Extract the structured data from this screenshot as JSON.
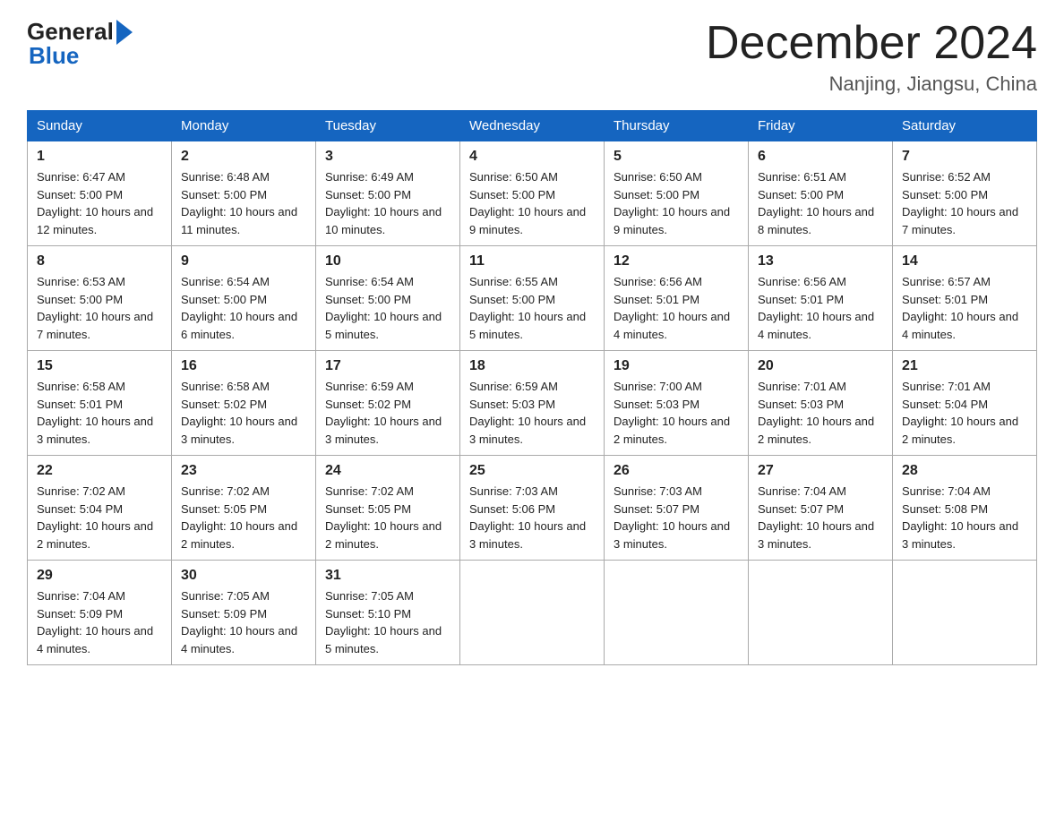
{
  "header": {
    "title": "December 2024",
    "location": "Nanjing, Jiangsu, China",
    "logo_general": "General",
    "logo_blue": "Blue"
  },
  "columns": [
    "Sunday",
    "Monday",
    "Tuesday",
    "Wednesday",
    "Thursday",
    "Friday",
    "Saturday"
  ],
  "weeks": [
    [
      {
        "day": "1",
        "sunrise": "6:47 AM",
        "sunset": "5:00 PM",
        "daylight": "10 hours and 12 minutes."
      },
      {
        "day": "2",
        "sunrise": "6:48 AM",
        "sunset": "5:00 PM",
        "daylight": "10 hours and 11 minutes."
      },
      {
        "day": "3",
        "sunrise": "6:49 AM",
        "sunset": "5:00 PM",
        "daylight": "10 hours and 10 minutes."
      },
      {
        "day": "4",
        "sunrise": "6:50 AM",
        "sunset": "5:00 PM",
        "daylight": "10 hours and 9 minutes."
      },
      {
        "day": "5",
        "sunrise": "6:50 AM",
        "sunset": "5:00 PM",
        "daylight": "10 hours and 9 minutes."
      },
      {
        "day": "6",
        "sunrise": "6:51 AM",
        "sunset": "5:00 PM",
        "daylight": "10 hours and 8 minutes."
      },
      {
        "day": "7",
        "sunrise": "6:52 AM",
        "sunset": "5:00 PM",
        "daylight": "10 hours and 7 minutes."
      }
    ],
    [
      {
        "day": "8",
        "sunrise": "6:53 AM",
        "sunset": "5:00 PM",
        "daylight": "10 hours and 7 minutes."
      },
      {
        "day": "9",
        "sunrise": "6:54 AM",
        "sunset": "5:00 PM",
        "daylight": "10 hours and 6 minutes."
      },
      {
        "day": "10",
        "sunrise": "6:54 AM",
        "sunset": "5:00 PM",
        "daylight": "10 hours and 5 minutes."
      },
      {
        "day": "11",
        "sunrise": "6:55 AM",
        "sunset": "5:00 PM",
        "daylight": "10 hours and 5 minutes."
      },
      {
        "day": "12",
        "sunrise": "6:56 AM",
        "sunset": "5:01 PM",
        "daylight": "10 hours and 4 minutes."
      },
      {
        "day": "13",
        "sunrise": "6:56 AM",
        "sunset": "5:01 PM",
        "daylight": "10 hours and 4 minutes."
      },
      {
        "day": "14",
        "sunrise": "6:57 AM",
        "sunset": "5:01 PM",
        "daylight": "10 hours and 4 minutes."
      }
    ],
    [
      {
        "day": "15",
        "sunrise": "6:58 AM",
        "sunset": "5:01 PM",
        "daylight": "10 hours and 3 minutes."
      },
      {
        "day": "16",
        "sunrise": "6:58 AM",
        "sunset": "5:02 PM",
        "daylight": "10 hours and 3 minutes."
      },
      {
        "day": "17",
        "sunrise": "6:59 AM",
        "sunset": "5:02 PM",
        "daylight": "10 hours and 3 minutes."
      },
      {
        "day": "18",
        "sunrise": "6:59 AM",
        "sunset": "5:03 PM",
        "daylight": "10 hours and 3 minutes."
      },
      {
        "day": "19",
        "sunrise": "7:00 AM",
        "sunset": "5:03 PM",
        "daylight": "10 hours and 2 minutes."
      },
      {
        "day": "20",
        "sunrise": "7:01 AM",
        "sunset": "5:03 PM",
        "daylight": "10 hours and 2 minutes."
      },
      {
        "day": "21",
        "sunrise": "7:01 AM",
        "sunset": "5:04 PM",
        "daylight": "10 hours and 2 minutes."
      }
    ],
    [
      {
        "day": "22",
        "sunrise": "7:02 AM",
        "sunset": "5:04 PM",
        "daylight": "10 hours and 2 minutes."
      },
      {
        "day": "23",
        "sunrise": "7:02 AM",
        "sunset": "5:05 PM",
        "daylight": "10 hours and 2 minutes."
      },
      {
        "day": "24",
        "sunrise": "7:02 AM",
        "sunset": "5:05 PM",
        "daylight": "10 hours and 2 minutes."
      },
      {
        "day": "25",
        "sunrise": "7:03 AM",
        "sunset": "5:06 PM",
        "daylight": "10 hours and 3 minutes."
      },
      {
        "day": "26",
        "sunrise": "7:03 AM",
        "sunset": "5:07 PM",
        "daylight": "10 hours and 3 minutes."
      },
      {
        "day": "27",
        "sunrise": "7:04 AM",
        "sunset": "5:07 PM",
        "daylight": "10 hours and 3 minutes."
      },
      {
        "day": "28",
        "sunrise": "7:04 AM",
        "sunset": "5:08 PM",
        "daylight": "10 hours and 3 minutes."
      }
    ],
    [
      {
        "day": "29",
        "sunrise": "7:04 AM",
        "sunset": "5:09 PM",
        "daylight": "10 hours and 4 minutes."
      },
      {
        "day": "30",
        "sunrise": "7:05 AM",
        "sunset": "5:09 PM",
        "daylight": "10 hours and 4 minutes."
      },
      {
        "day": "31",
        "sunrise": "7:05 AM",
        "sunset": "5:10 PM",
        "daylight": "10 hours and 5 minutes."
      },
      null,
      null,
      null,
      null
    ]
  ]
}
